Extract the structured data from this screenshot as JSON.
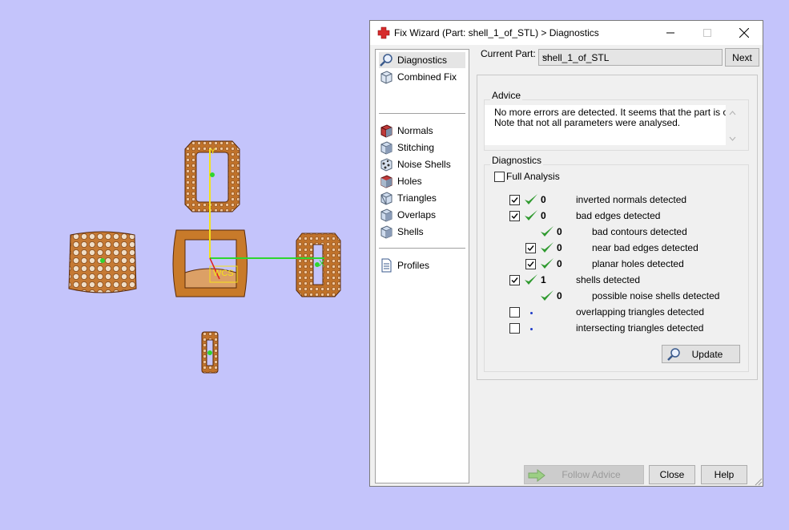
{
  "window": {
    "title": "Fix Wizard (Part: shell_1_of_STL) > Diagnostics",
    "minimize_icon": "minimize-icon",
    "maximize_icon": "maximize-icon",
    "close_icon": "close-icon"
  },
  "nav": {
    "items": [
      {
        "label": "Diagnostics",
        "icon": "magnifier-icon"
      },
      {
        "label": "Combined Fix",
        "icon": "cube-icon"
      },
      {
        "label": "Normals",
        "icon": "normals-cube-icon"
      },
      {
        "label": "Stitching",
        "icon": "stitching-cube-icon"
      },
      {
        "label": "Noise Shells",
        "icon": "noise-shells-icon"
      },
      {
        "label": "Holes",
        "icon": "holes-cube-icon"
      },
      {
        "label": "Triangles",
        "icon": "triangles-cube-icon"
      },
      {
        "label": "Overlaps",
        "icon": "overlaps-cube-icon"
      },
      {
        "label": "Shells",
        "icon": "shells-cube-icon"
      },
      {
        "label": "Profiles",
        "icon": "document-icon"
      }
    ]
  },
  "current_part": {
    "label": "Current Part:",
    "value": "shell_1_of_STL",
    "next": "Next"
  },
  "advice": {
    "title": "Advice",
    "line1": "No more errors are detected. It seems that the part is ok.",
    "line2": "Note that not all parameters were analysed."
  },
  "diagnostics": {
    "title": "Diagnostics",
    "full_analysis": "Full Analysis",
    "rows": [
      {
        "count": "0",
        "label": "inverted normals detected"
      },
      {
        "count": "0",
        "label": "bad edges detected"
      },
      {
        "count": "0",
        "label": "bad contours detected"
      },
      {
        "count": "0",
        "label": "near bad edges detected"
      },
      {
        "count": "0",
        "label": "planar holes detected"
      },
      {
        "count": "1",
        "label": "shells detected"
      },
      {
        "count": "0",
        "label": "possible noise shells detected"
      },
      {
        "count": "",
        "label": "overlapping triangles detected"
      },
      {
        "count": "",
        "label": "intersecting triangles detected"
      }
    ],
    "update": "Update"
  },
  "footer": {
    "follow_advice": "Follow Advice",
    "close": "Close",
    "help": "Help"
  },
  "viewport": {
    "axis_x_label": "X",
    "axis_y_label": "Y",
    "wcs_label": "WCS",
    "part_color": "#c87a2a",
    "background": "#c4c4fb"
  }
}
